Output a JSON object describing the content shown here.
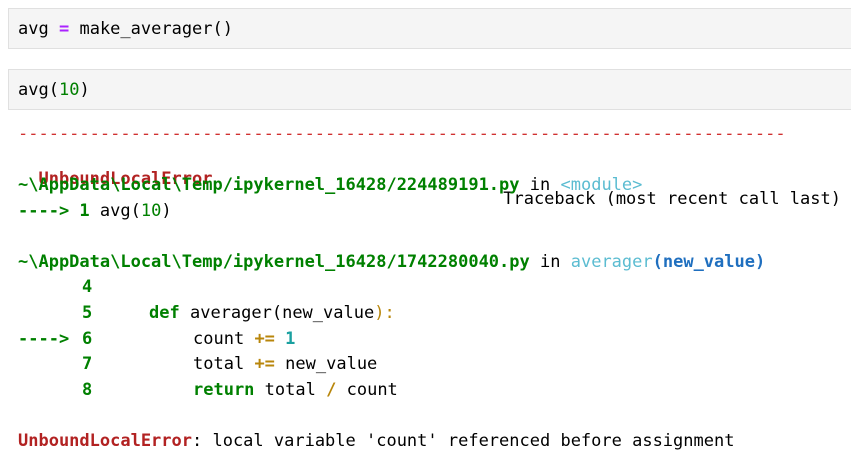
{
  "cells": [
    {
      "id": "cell-1",
      "code": {
        "var": "avg",
        "op": "=",
        "call": "make_averager()"
      }
    },
    {
      "id": "cell-2",
      "code": {
        "fn": "avg(",
        "arg": "10",
        "close": ")"
      }
    }
  ],
  "traceback": {
    "dashes": "---------------------------------------------------------------------------",
    "error_name": "UnboundLocalError",
    "header_right": "Traceback (most recent call last)",
    "frame1": {
      "path": "~\\AppData\\Local\\Temp/ipykernel_16428/224489191.py",
      "in_word": "in",
      "func": "<module>",
      "arrow": "----> 1",
      "code_fn": "avg(",
      "code_arg": "10",
      "code_close": ")"
    },
    "frame2": {
      "path": "~\\AppData\\Local\\Temp/ipykernel_16428/1742280040.py",
      "in_word": "in",
      "func": "averager",
      "func_args": "(new_value)",
      "lines": [
        {
          "arrow": "",
          "num": "4"
        },
        {
          "arrow": "",
          "num": "5"
        },
        {
          "arrow": "---->",
          "num": "6"
        },
        {
          "arrow": "",
          "num": "7"
        },
        {
          "arrow": "",
          "num": "8"
        }
      ],
      "line5": {
        "kw": "def",
        "rest": "averager(new_value",
        "colon": "):"
      },
      "line6": {
        "var": "count",
        "op": "+=",
        "num": "1"
      },
      "line7": {
        "var": "total",
        "op": "+=",
        "rest": "new_value"
      },
      "line8": {
        "kw": "return",
        "var": "total",
        "op": "/",
        "rest": "count"
      }
    },
    "final_error": "UnboundLocalError",
    "final_message": ": local variable 'count' referenced before assignment"
  }
}
